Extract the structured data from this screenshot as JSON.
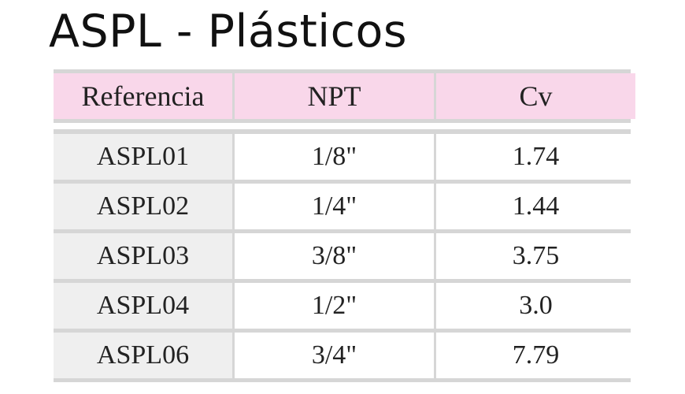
{
  "title": "ASPL - Plásticos",
  "table": {
    "headers": [
      "Referencia",
      "NPT",
      "Cv"
    ],
    "rows": [
      [
        "ASPL01",
        "1/8\"",
        "1.74"
      ],
      [
        "ASPL02",
        "1/4\"",
        "1.44"
      ],
      [
        "ASPL03",
        "3/8\"",
        "3.75"
      ],
      [
        "ASPL04",
        "1/2\"",
        "3.0"
      ],
      [
        "ASPL06",
        "3/4\"",
        "7.79"
      ]
    ]
  },
  "colors": {
    "header_bg": "#f9d7ea",
    "reference_column_bg": "#efefef",
    "grid_lines": "#d6d6d6"
  }
}
